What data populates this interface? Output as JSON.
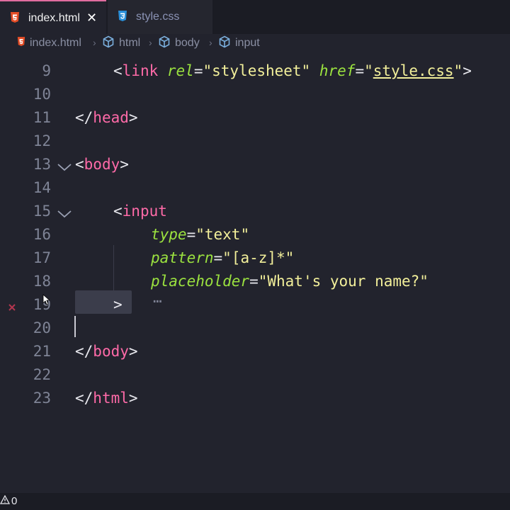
{
  "tabs": [
    {
      "label": "index.html",
      "icon": "html5-icon",
      "active": true
    },
    {
      "label": "style.css",
      "icon": "css3-icon",
      "active": false
    }
  ],
  "breadcrumb": [
    {
      "label": "index.html",
      "icon": "html5-icon"
    },
    {
      "label": "html",
      "icon": "symbol-cube-icon"
    },
    {
      "label": "body",
      "icon": "symbol-cube-icon"
    },
    {
      "label": "input",
      "icon": "symbol-cube-icon"
    }
  ],
  "editor": {
    "line_numbers": [
      "9",
      "10",
      "11",
      "12",
      "13",
      "14",
      "15",
      "16",
      "17",
      "18",
      "19",
      "20",
      "21",
      "22",
      "23"
    ],
    "line9": {
      "open": "<",
      "tag": "link",
      "attr1": "rel",
      "eq1": "=",
      "val1": "\"stylesheet\"",
      "attr2": "href",
      "eq2": "=",
      "q1": "\"",
      "val2": "style.css",
      "q2": "\"",
      "close": ">"
    },
    "line11": {
      "open": "</",
      "tag": "head",
      "close": ">"
    },
    "line13": {
      "open": "<",
      "tag": "body",
      "close": ">"
    },
    "line15": {
      "open": "<",
      "tag": "input"
    },
    "line16": {
      "attr": "type",
      "eq": "=",
      "val": "\"text\""
    },
    "line17": {
      "attr": "pattern",
      "eq": "=",
      "val": "\"[a-z]*\""
    },
    "line18": {
      "attr": "placeholder",
      "eq": "=",
      "val": "\"What's your name?\""
    },
    "line19": {
      "dots": "⋯",
      "close": ">"
    },
    "line21": {
      "open": "</",
      "tag": "body",
      "close": ">"
    },
    "line23": {
      "open": "</",
      "tag": "html",
      "close": ">"
    }
  },
  "status": {
    "warnings": "0"
  },
  "colors": {
    "tag": "#ff6aa8",
    "attr": "#9be23f",
    "string": "#f2ef9a",
    "background": "#22232d"
  }
}
